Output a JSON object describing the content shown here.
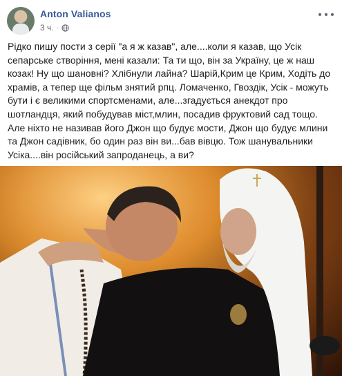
{
  "post": {
    "author": "Anton Valianos",
    "time": "3 ч.",
    "separator": "·",
    "privacy_icon": "globe-icon",
    "more_icon": "more-options-icon",
    "text": "Рідко пишу пости з серії \"а я ж казав\", але....коли я казав, що Усік сепарське створіння, мені казали: Та ти що, він за Україну, це ж наш козак! Ну що шановні? Хлібнули лайна? Шарій,Крим це Крим, Ходіть до храмів, а тепер ще фільм знятий рпц. Ломаченко, Гвоздік, Усік - можуть бути і є великими спортсменами, але...згадується анекдот про шотландця, який побудував міст,млин, посадив фруктовий сад тощо. Але ніхто не називав його Джон що будує мости, Джон що будує млини та Джон садівник, бо один раз він ви...бав вівцю. Тож шанувальники Усіка....він російський запроданець, а ви?"
  },
  "colors": {
    "author_link": "#385898",
    "meta_text": "#606770",
    "body_text": "#1c1e21"
  }
}
